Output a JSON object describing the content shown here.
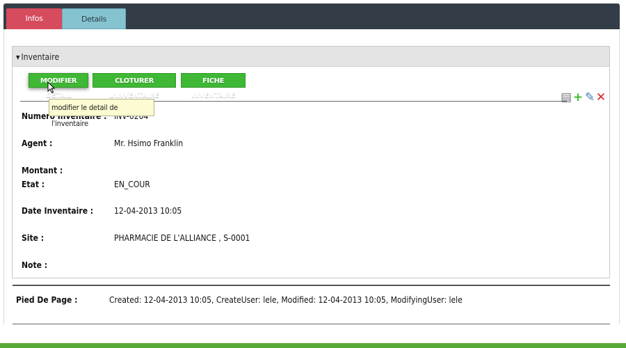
{
  "tabs": [
    {
      "label": "Infos Inventaire",
      "active": true
    },
    {
      "label": "Details Inventaires",
      "active": false
    }
  ],
  "fieldset": {
    "legend": "Inventaire",
    "actions": {
      "modify": "MODIFIER DETAIL",
      "close": "CLOTURER L'INVENTAIRE",
      "sheet": "FICHE INVENTAIRE"
    },
    "tooltip": "modifier le detail de l'inventaire",
    "icons": [
      "books-icon",
      "add-icon",
      "edit-icon",
      "delete-icon"
    ],
    "fields": {
      "numero": {
        "label": "Numero Inventaire :",
        "value": "INV-0204"
      },
      "agent": {
        "label": "Agent :",
        "value": "Mr. Hsimo Franklin"
      },
      "montant": {
        "label": "Montant :",
        "value": ""
      },
      "etat": {
        "label": "Etat :",
        "value": "EN_COUR"
      },
      "date": {
        "label": "Date Inventaire :",
        "value": "12-04-2013 10:05"
      },
      "site": {
        "label": "Site :",
        "value": "PHARMACIE DE L'ALLIANCE , S-0001"
      },
      "note": {
        "label": "Note :",
        "value": ""
      }
    }
  },
  "footer": {
    "label": "Pied De Page :",
    "value": "Created: 12-04-2013 10:05, CreateUser: lele, Modified: 12-04-2013 10:05, ModifyingUser: lele"
  },
  "colors": {
    "tab_active": "#d74b5e",
    "tab_inactive": "#85c3d0",
    "tabbar": "#333d47",
    "button_green": "#3fb835",
    "tooltip_bg": "#fdfbd1",
    "bottom_strip": "#58a838"
  }
}
